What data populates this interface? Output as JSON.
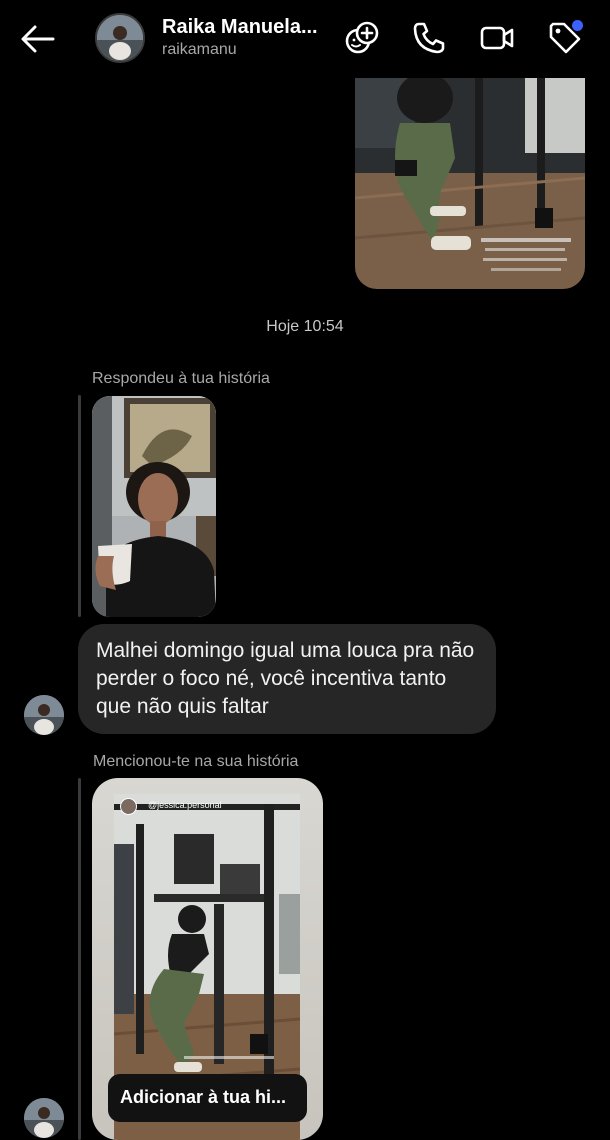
{
  "header": {
    "title": "Raika Manuela...",
    "username": "raikamanu",
    "icons": [
      "back-arrow-icon",
      "sticker-icon",
      "phone-icon",
      "video-icon",
      "tag-icon"
    ],
    "notification_dot_color": "#3a62ff"
  },
  "timestamp": "Hoje 10:54",
  "story_reply": {
    "label": "Respondeu à tua história"
  },
  "message": {
    "text": "Malhei domingo igual uma louca pra não perder o foco né, você incentiva tanto que não quis faltar"
  },
  "mention": {
    "label": "Mencionou-te na sua história",
    "story_user": "@jessica.personal",
    "button_label": "Adicionar à tua hi..."
  },
  "colors": {
    "background": "#000000",
    "bubble": "#262626",
    "secondary_text": "#a8a8a8"
  }
}
